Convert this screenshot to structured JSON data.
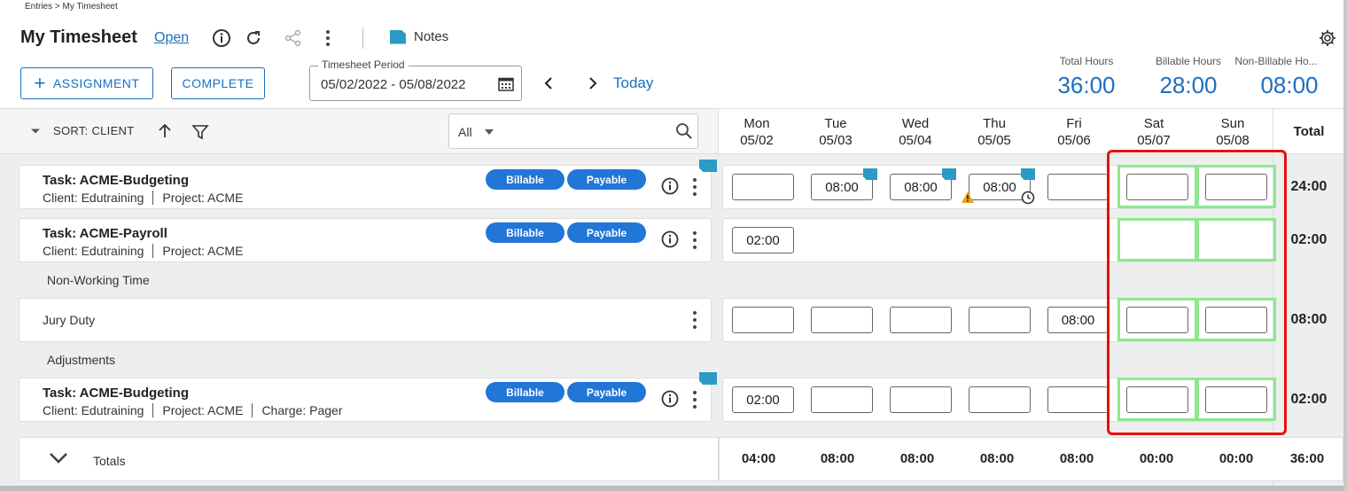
{
  "breadcrumb": "Entries > My Timesheet",
  "title": "My Timesheet",
  "status": "Open",
  "notes_label": "Notes",
  "buttons": {
    "assignment": "ASSIGNMENT",
    "complete": "COMPLETE"
  },
  "period": {
    "label": "Timesheet Period",
    "value": "05/02/2022 - 05/08/2022"
  },
  "today": "Today",
  "summary": {
    "total_label": "Total Hours",
    "total_value": "36:00",
    "billable_label": "Billable Hours",
    "billable_value": "28:00",
    "nonbillable_label": "Non-Billable Ho...",
    "nonbillable_value": "08:00"
  },
  "sort_label": "SORT: CLIENT",
  "filter_value": "All",
  "days": [
    {
      "name": "Mon",
      "date": "05/02"
    },
    {
      "name": "Tue",
      "date": "05/03"
    },
    {
      "name": "Wed",
      "date": "05/04"
    },
    {
      "name": "Thu",
      "date": "05/05"
    },
    {
      "name": "Fri",
      "date": "05/06"
    },
    {
      "name": "Sat",
      "date": "05/07"
    },
    {
      "name": "Sun",
      "date": "05/08"
    }
  ],
  "total_header": "Total",
  "rows": [
    {
      "title": "Task: ACME-Budgeting",
      "client": "Client: Edutraining",
      "project": "Project: ACME",
      "charge": "",
      "billable": "Billable",
      "payable": "Payable",
      "cells": [
        "",
        "08:00",
        "08:00",
        "08:00",
        "",
        "",
        ""
      ],
      "total": "24:00"
    },
    {
      "title": "Task: ACME-Payroll",
      "client": "Client: Edutraining",
      "project": "Project: ACME",
      "charge": "",
      "billable": "Billable",
      "payable": "Payable",
      "cells": [
        "02:00",
        "",
        "",
        "",
        "",
        "",
        ""
      ],
      "total": "02:00"
    },
    {
      "section": "Non-Working Time",
      "title": "Jury Duty",
      "cells": [
        "",
        "",
        "",
        "",
        "08:00",
        "",
        ""
      ],
      "total": "08:00"
    },
    {
      "section": "Adjustments",
      "title": "Task: ACME-Budgeting",
      "client": "Client: Edutraining",
      "project": "Project: ACME",
      "charge": "Charge: Pager",
      "billable": "Billable",
      "payable": "Payable",
      "cells": [
        "02:00",
        "",
        "",
        "",
        "",
        "",
        ""
      ],
      "total": "02:00"
    }
  ],
  "totals": {
    "label": "Totals",
    "values": [
      "04:00",
      "08:00",
      "08:00",
      "08:00",
      "08:00",
      "00:00",
      "00:00"
    ],
    "grand_total": "36:00"
  },
  "colors": {
    "accent": "#1a6fc0",
    "pill": "#2176d6",
    "highlight_red": "#e51111",
    "highlight_green": "#8ee88e"
  }
}
